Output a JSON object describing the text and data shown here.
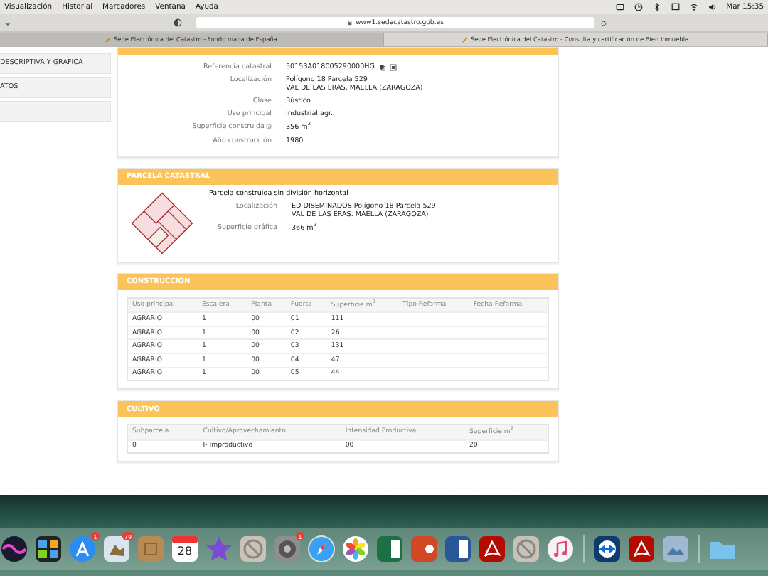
{
  "menu_bar": {
    "items": [
      "Visualización",
      "Historial",
      "Marcadores",
      "Ventana",
      "Ayuda"
    ],
    "clock": "Mar 15:35"
  },
  "browser": {
    "url": "www1.sedecatastro.gob.es",
    "tabs": [
      {
        "title": "Sede Electrónica del Catastro - Fondo mapa de España",
        "selected": false
      },
      {
        "title": "Sede Electrónica del Catastro - Consulta y certificación de Bien Inmueble",
        "selected": true
      }
    ]
  },
  "sidebar": {
    "items": [
      {
        "kind": "link",
        "label": "DESCRIPTIVA Y GRÁFICA"
      },
      {
        "kind": "link",
        "label": "ATOS"
      },
      {
        "kind": "blank"
      }
    ]
  },
  "property": {
    "fields": [
      {
        "label": "Referencia catastral",
        "lines": [
          "50153A018005290000HG"
        ],
        "kind": "reference"
      },
      {
        "label": "Localización",
        "lines": [
          "Polígono 18 Parcela 529",
          "VAL DE LAS ERAS. MAELLA (ZARAGOZA)"
        ],
        "kind": "plain"
      },
      {
        "label": "Clase",
        "lines": [
          "Rústico"
        ],
        "kind": "plain"
      },
      {
        "label": "Uso principal",
        "lines": [
          "Industrial agr."
        ],
        "kind": "plain"
      },
      {
        "label": "Superficie construida",
        "lines": [
          "356 m$^{2}$"
        ],
        "kind": "info"
      },
      {
        "label": "Año construcción",
        "lines": [
          "1980"
        ],
        "kind": "plain"
      }
    ]
  },
  "parcel": {
    "title": "PARCELA CATASTRAL",
    "subtitle": "Parcela construida sin división horizontal",
    "fields": [
      {
        "label": "Localización",
        "lines": [
          "ED DISEMINADOS Polígono 18 Parcela 529",
          "VAL DE LAS ERAS. MAELLA (ZARAGOZA)"
        ]
      },
      {
        "label": "Superficie gráfica",
        "lines": [
          "366 m$^{2}$"
        ]
      }
    ]
  },
  "construction": {
    "title": "CONSTRUCCIÓN",
    "columns": [
      "Uso principal",
      "Escalera",
      "Planta",
      "Puerta",
      "Superficie m$^{2}$",
      "Tipo Reforma",
      "Fecha Reforma"
    ],
    "rows": [
      [
        "AGRARIO",
        "1",
        "00",
        "01",
        "111"
      ],
      [
        "AGRARIO",
        "1",
        "00",
        "02",
        "26"
      ],
      [
        "AGRARIO",
        "1",
        "00",
        "03",
        "131"
      ],
      [
        "AGRARIO",
        "1",
        "00",
        "04",
        "47"
      ],
      [
        "AGRARIO",
        "1",
        "00",
        "05",
        "44"
      ]
    ]
  },
  "cultivation": {
    "title": "CULTIVO",
    "columns": [
      "Subparcela",
      "Cultivo/Aprovechamiento",
      "Intensidad Productiva",
      "Superficie m$^{2}$"
    ],
    "rows": [
      [
        "0",
        "I- Improductivo",
        "00",
        "20"
      ]
    ]
  },
  "dock": [
    {
      "kind": "siri"
    },
    {
      "kind": "mission"
    },
    {
      "kind": "appstore",
      "badge": "1"
    },
    {
      "kind": "mail",
      "badge": "79"
    },
    {
      "kind": "notebook"
    },
    {
      "kind": "calendar",
      "label": "28"
    },
    {
      "kind": "imovie"
    },
    {
      "kind": "blocked"
    },
    {
      "kind": "prefs",
      "badge": "1"
    },
    {
      "kind": "safari"
    },
    {
      "kind": "photos"
    },
    {
      "kind": "excel"
    },
    {
      "kind": "powerpoint"
    },
    {
      "kind": "word"
    },
    {
      "kind": "acrobat"
    },
    {
      "kind": "blocked"
    },
    {
      "kind": "music"
    },
    {
      "kind": "separator"
    },
    {
      "kind": "teamviewer"
    },
    {
      "kind": "acrobat"
    },
    {
      "kind": "preview"
    },
    {
      "kind": "separator"
    },
    {
      "kind": "folder"
    }
  ]
}
